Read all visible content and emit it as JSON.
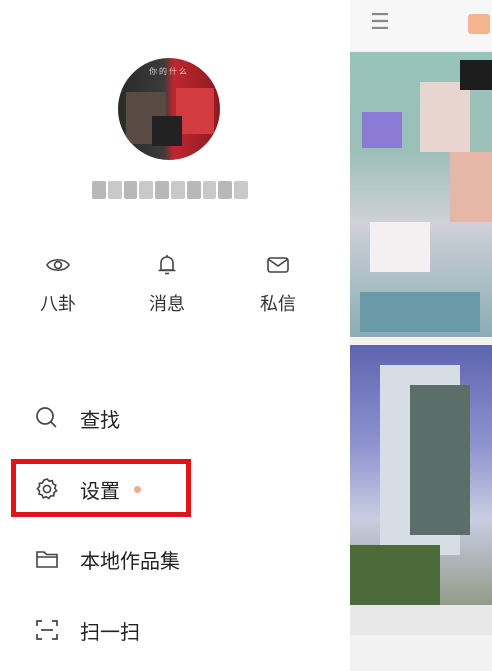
{
  "profile": {
    "avatar_caption": "你的什么"
  },
  "quick_actions": [
    {
      "icon": "eye-icon",
      "label": "八卦"
    },
    {
      "icon": "bell-icon",
      "label": "消息"
    },
    {
      "icon": "mail-icon",
      "label": "私信"
    }
  ],
  "menu": [
    {
      "icon": "search-icon",
      "label": "查找"
    },
    {
      "icon": "gear-icon",
      "label": "设置",
      "has_badge_dot": true
    },
    {
      "icon": "folder-icon",
      "label": "本地作品集"
    },
    {
      "icon": "scan-icon",
      "label": "扫一扫"
    }
  ],
  "colors": {
    "highlight_box": "#e0141b",
    "badge_dot": "#f0a98a",
    "icon_stroke": "#444444"
  }
}
